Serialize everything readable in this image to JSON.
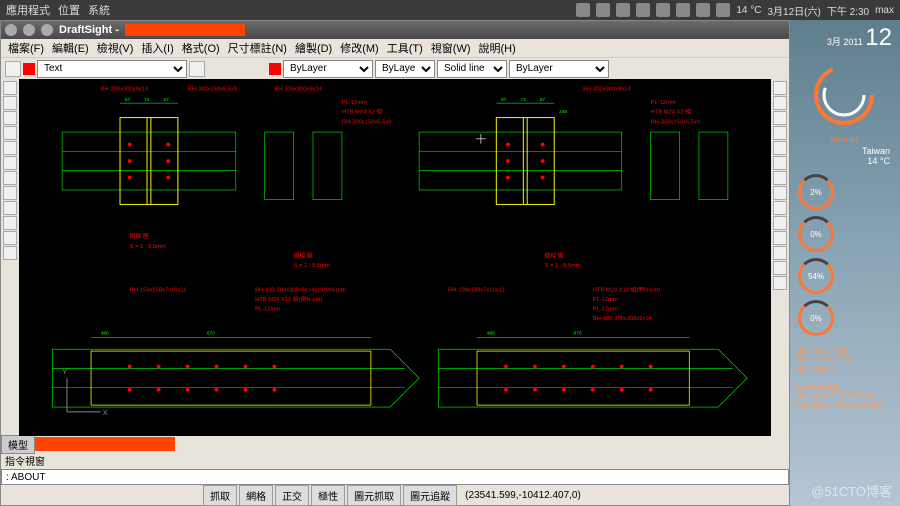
{
  "os_topbar": {
    "menus": [
      "應用程式",
      "位置",
      "系統"
    ],
    "temp": "14 °C",
    "date": "3月12日(六)",
    "time": "下午 2:30",
    "user": "max"
  },
  "window": {
    "title": "DraftSight -"
  },
  "menubar": [
    "檔案(F)",
    "編輯(E)",
    "檢視(V)",
    "插入(I)",
    "格式(O)",
    "尺寸標註(N)",
    "繪製(D)",
    "修改(M)",
    "工具(T)",
    "視窗(W)",
    "說明(H)"
  ],
  "prop_toolbar": {
    "layer": "Text",
    "color": "ByLayer",
    "linetype_mode": "ByLayer",
    "linetype": "Solid line",
    "lineweight": "ByLayer"
  },
  "tabs": {
    "model": "模型"
  },
  "command": {
    "label": "指令視窗",
    "value": ": ABOUT"
  },
  "statusbar": {
    "buttons": [
      "抓取",
      "網格",
      "正交",
      "極性",
      "圖元抓取",
      "圖元追蹤"
    ],
    "coords": "(23541.599,-10412.407,0)"
  },
  "desktop": {
    "month": "3月",
    "year": "2011",
    "day": "12",
    "brand": "ubuntu",
    "weather_loc": "Taiwan",
    "weather_temp": "14 °C",
    "gauges": [
      "2%",
      "0%",
      "54%",
      "0%"
    ],
    "uptime": "Uptime: 3h 3m",
    "processes": "Processes: 278",
    "running": "Running: 0",
    "host": "doo-desktop",
    "distro1": "Ubuntu 10.10 i386_64",
    "distro2": "Kernel 2.6.35-25-generic"
  },
  "watermark": "@51CTO博客",
  "drawing_labels": {
    "bh300": "BH-300x300x9x14",
    "rh300": "RH-300x150x5.5x9",
    "pl12": "PL-12mm",
    "htb_m24x2": "HTB M24 X2 組",
    "htb_m24x12": "HTB M24 X12 組(倒N-pat)",
    "rh158": "RH-158x158x7x10x11",
    "bh430": "BH-430-300x308x8x14x13(MN-pat)",
    "rh198": "RH-198x198x7x10x11",
    "bh488": "BH-488-300x308x9x14",
    "scale": "S = 1 : 8.5mm",
    "detail": "鋼樑 圖"
  }
}
